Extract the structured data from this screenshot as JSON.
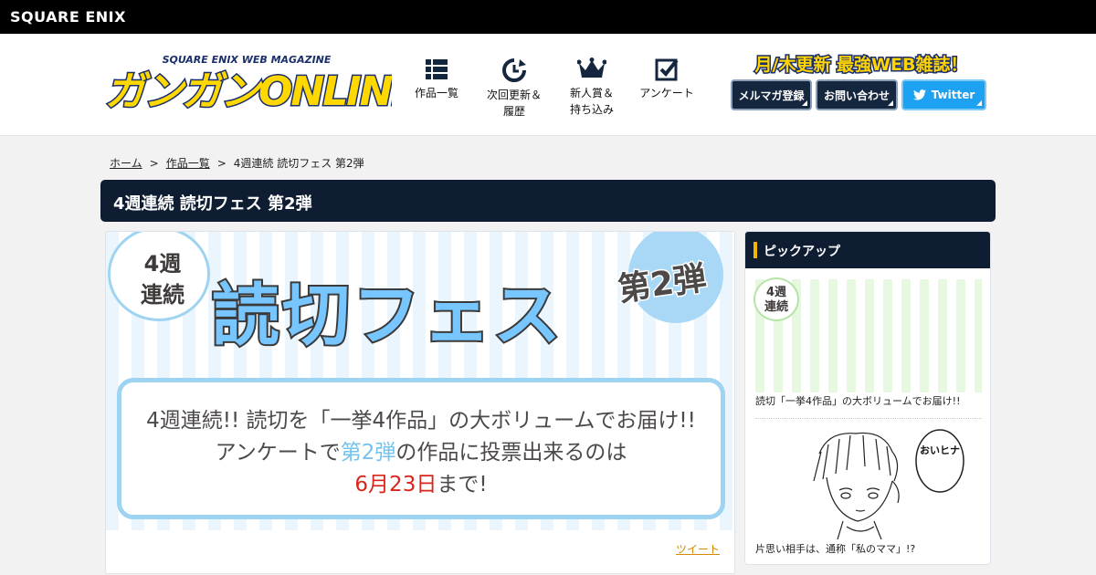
{
  "brand": "SQUARE ENIX",
  "logo": {
    "text": "ガンガンONLINE",
    "sub": "SQUARE ENIX WEB MAGAZINE"
  },
  "nav": [
    {
      "label": "作品一覧",
      "icon": "grid-list-icon"
    },
    {
      "label": "次回更新＆\n履歴",
      "icon": "history-clock-icon"
    },
    {
      "label": "新人賞＆\n持ち込み",
      "icon": "crown-icon"
    },
    {
      "label": "アンケート",
      "icon": "checkbox-icon"
    }
  ],
  "tagline": "月/木更新 最強WEB雑誌！",
  "header_buttons": {
    "newsletter": "メルマガ登録",
    "contact": "お問い合わせ",
    "twitter": "Twitter"
  },
  "breadcrumb": {
    "home": "ホーム",
    "works": "作品一覧",
    "current": "4週連続 読切フェス 第2弾"
  },
  "page_title": "4週連続 読切フェス 第2弾",
  "banner": {
    "bubble": "4週\n連続",
    "title": "読切フェス",
    "dan": "第2弾",
    "line1": "4週連続!! 読切を「一挙4作品」の大ボリュームでお届け!!",
    "line2_pre": "アンケートで",
    "line2_blue": "第2弾",
    "line2_post": "の作品に投票出来るのは",
    "line3_red": "6月23日",
    "line3_post": "まで!"
  },
  "tweet_link": "ツイート",
  "pickup": {
    "heading": "ピックアップ",
    "items": [
      {
        "badge": "4週\n連続",
        "caption": "読切「一挙4作品」の大ボリュームでお届け!!"
      },
      {
        "bubble": "おいヒナ",
        "caption": "片思い相手は、通称「私のママ」!?"
      }
    ]
  },
  "colors": {
    "navy": "#0f1d33",
    "twitter": "#1da1f2",
    "banner_blue": "#78c6ff",
    "accent_red": "#d9261c",
    "link_orange": "#d48a00"
  }
}
